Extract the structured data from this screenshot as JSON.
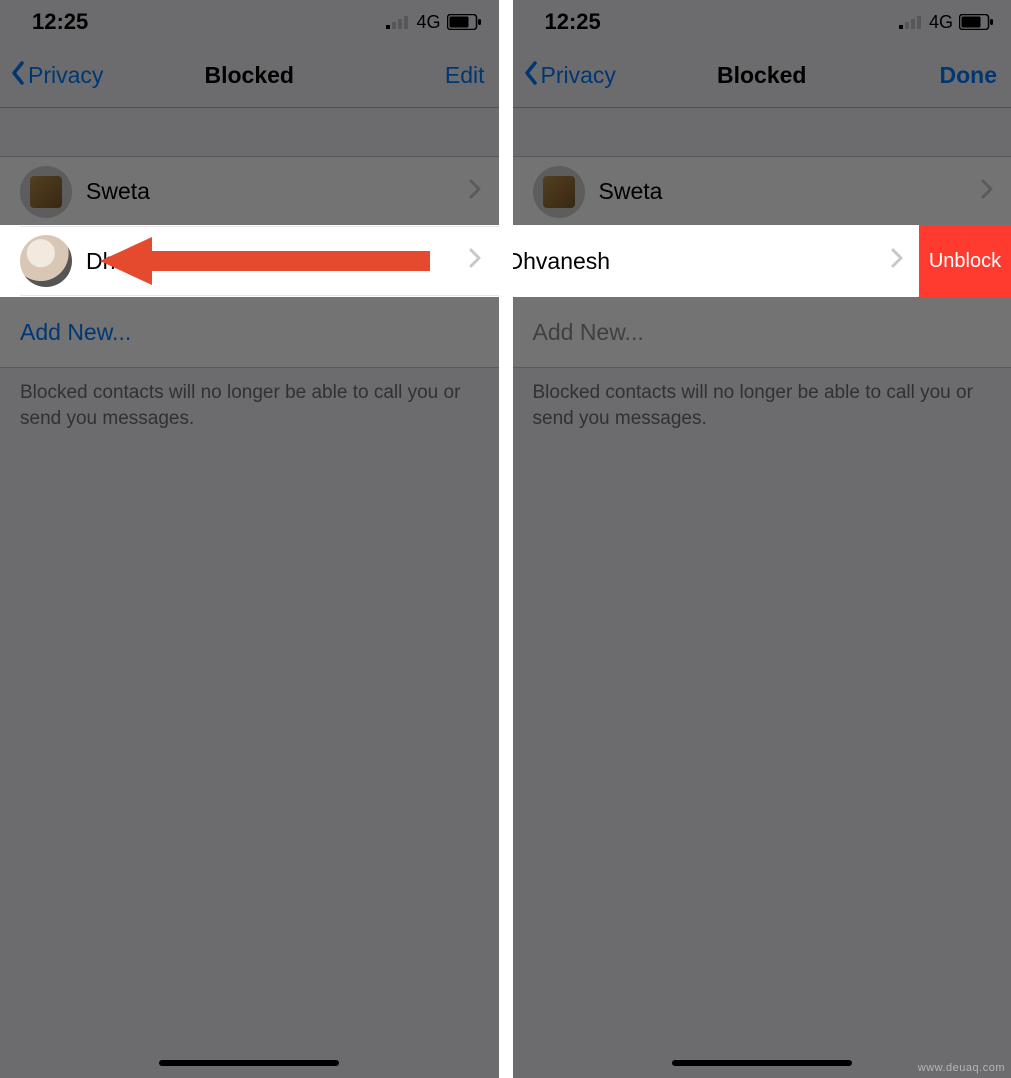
{
  "status": {
    "time": "12:25",
    "network_label": "4G"
  },
  "nav": {
    "back_label": "Privacy",
    "title": "Blocked",
    "edit_label": "Edit",
    "done_label": "Done"
  },
  "contacts": [
    {
      "name": "Sweta"
    },
    {
      "name": "Dhvanesh"
    }
  ],
  "add_new_label": "Add New...",
  "footer_text": "Blocked contacts will no longer be able to call you or send you messages.",
  "swipe_action_label": "Unblock",
  "watermark": "www.deuaq.com"
}
